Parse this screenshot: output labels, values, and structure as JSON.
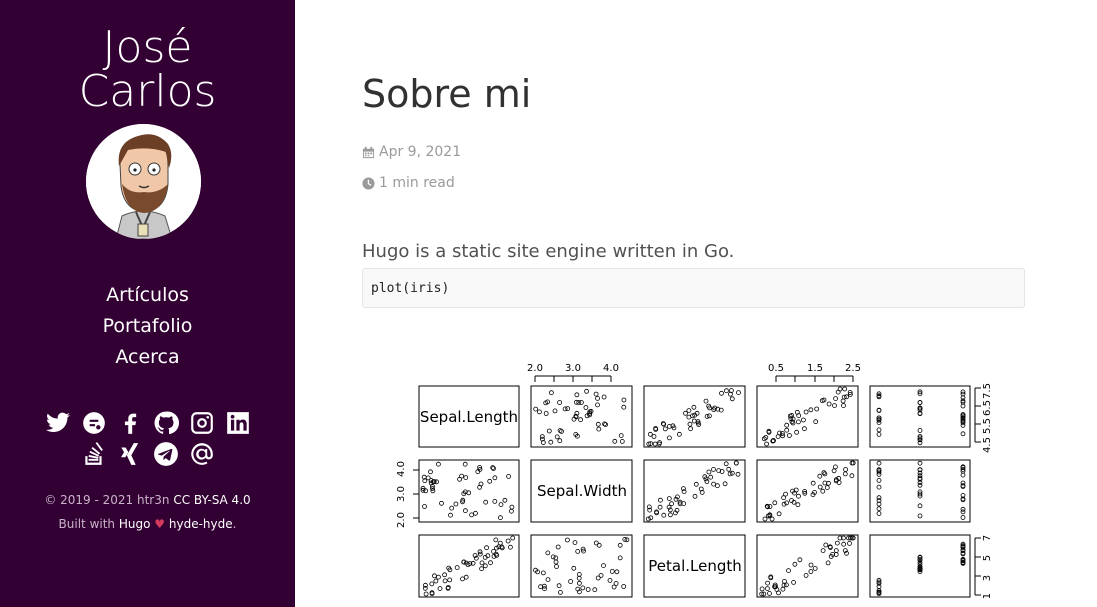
{
  "sidebar": {
    "title_line1": "José",
    "title_line2": "Carlos",
    "nav": [
      "Artículos",
      "Portafolio",
      "Acerca"
    ],
    "social_row1": [
      "twitter-icon",
      "keybase-icon",
      "facebook-icon",
      "github-icon",
      "instagram-icon",
      "linkedin-icon"
    ],
    "social_row2": [
      "stackoverflow-icon",
      "xing-icon",
      "telegram-icon",
      "email-icon"
    ],
    "footer": {
      "copyright": "© 2019 - 2021 htr3n",
      "license": "CC BY-SA 4.0",
      "built_with": "Built with",
      "hugo": "Hugo",
      "heart": "♥",
      "theme": "hyde-hyde",
      "period": "."
    }
  },
  "post": {
    "title": "Sobre mi",
    "date": "Apr 9, 2021",
    "read_time": "1 min read",
    "intro": "Hugo is a static site engine written in Go.",
    "code": "plot(iris)"
  },
  "plot": {
    "panels": [
      "Sepal.Length",
      "Sepal.Width",
      "Petal.Length"
    ],
    "top_ticks_col2": [
      "2.0",
      "3.0",
      "4.0"
    ],
    "top_ticks_col4": [
      "0.5",
      "1.5",
      "2.5"
    ],
    "right_ticks_row1": [
      "4.5",
      "5.5",
      "6.5",
      "7.5"
    ],
    "right_ticks_row3": [
      "1",
      "3",
      "5",
      "7"
    ],
    "left_ticks_row2": [
      "2.0",
      "3.0",
      "4.0"
    ]
  },
  "colors": {
    "sidebar": "#330033",
    "heart": "#d33a5e"
  }
}
